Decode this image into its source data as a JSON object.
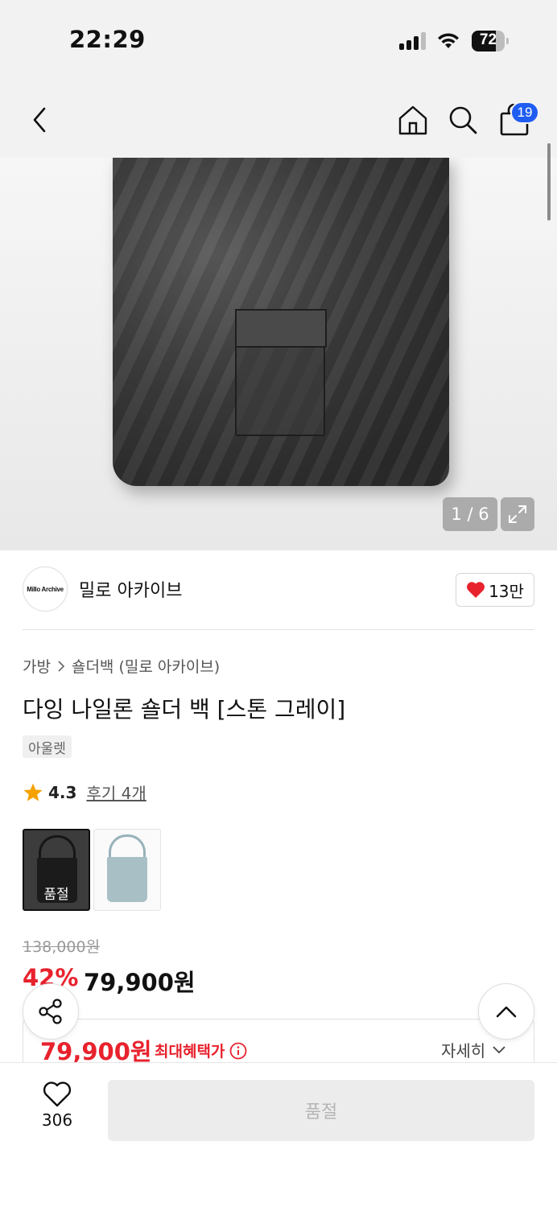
{
  "status_bar": {
    "time": "22:29",
    "battery_percent": "72",
    "battery_level": 0.72
  },
  "nav": {
    "cart_count": "19"
  },
  "gallery": {
    "counter": "1 / 6",
    "current": 1,
    "total": 6
  },
  "brand": {
    "logo_text": "Millo Archive",
    "name": "밀로 아카이브",
    "like_count": "13만"
  },
  "breadcrumb": {
    "category": "가방",
    "subcategory": "숄더백 (밀로 아카이브)"
  },
  "product": {
    "title": "다잉 나일론 숄더 백 [스톤 그레이]",
    "tag": "아울렛",
    "rating": "4.3",
    "reviews": "후기 4개"
  },
  "options": [
    {
      "name": "stone-gray",
      "soldout_label": "품절",
      "selected": true
    },
    {
      "name": "light-blue",
      "selected": false
    }
  ],
  "price": {
    "original": "138,000원",
    "discount": "42%",
    "sale": "79,900원",
    "max_benefit_price": "79,900원",
    "max_benefit_label": "최대혜택가",
    "detail_label": "자세히"
  },
  "bottom_bar": {
    "wish_count": "306",
    "buy_label": "품절"
  },
  "colors": {
    "accent_red": "#e8222d",
    "badge_blue": "#1f5cf2",
    "disabled_bg": "#ececec"
  },
  "icons": [
    "back-icon",
    "home-icon",
    "search-icon",
    "cart-icon",
    "expand-icon",
    "heart-icon",
    "star-icon",
    "info-icon",
    "chevron-down-icon",
    "share-icon",
    "chevron-up-icon",
    "heart-outline-icon"
  ]
}
